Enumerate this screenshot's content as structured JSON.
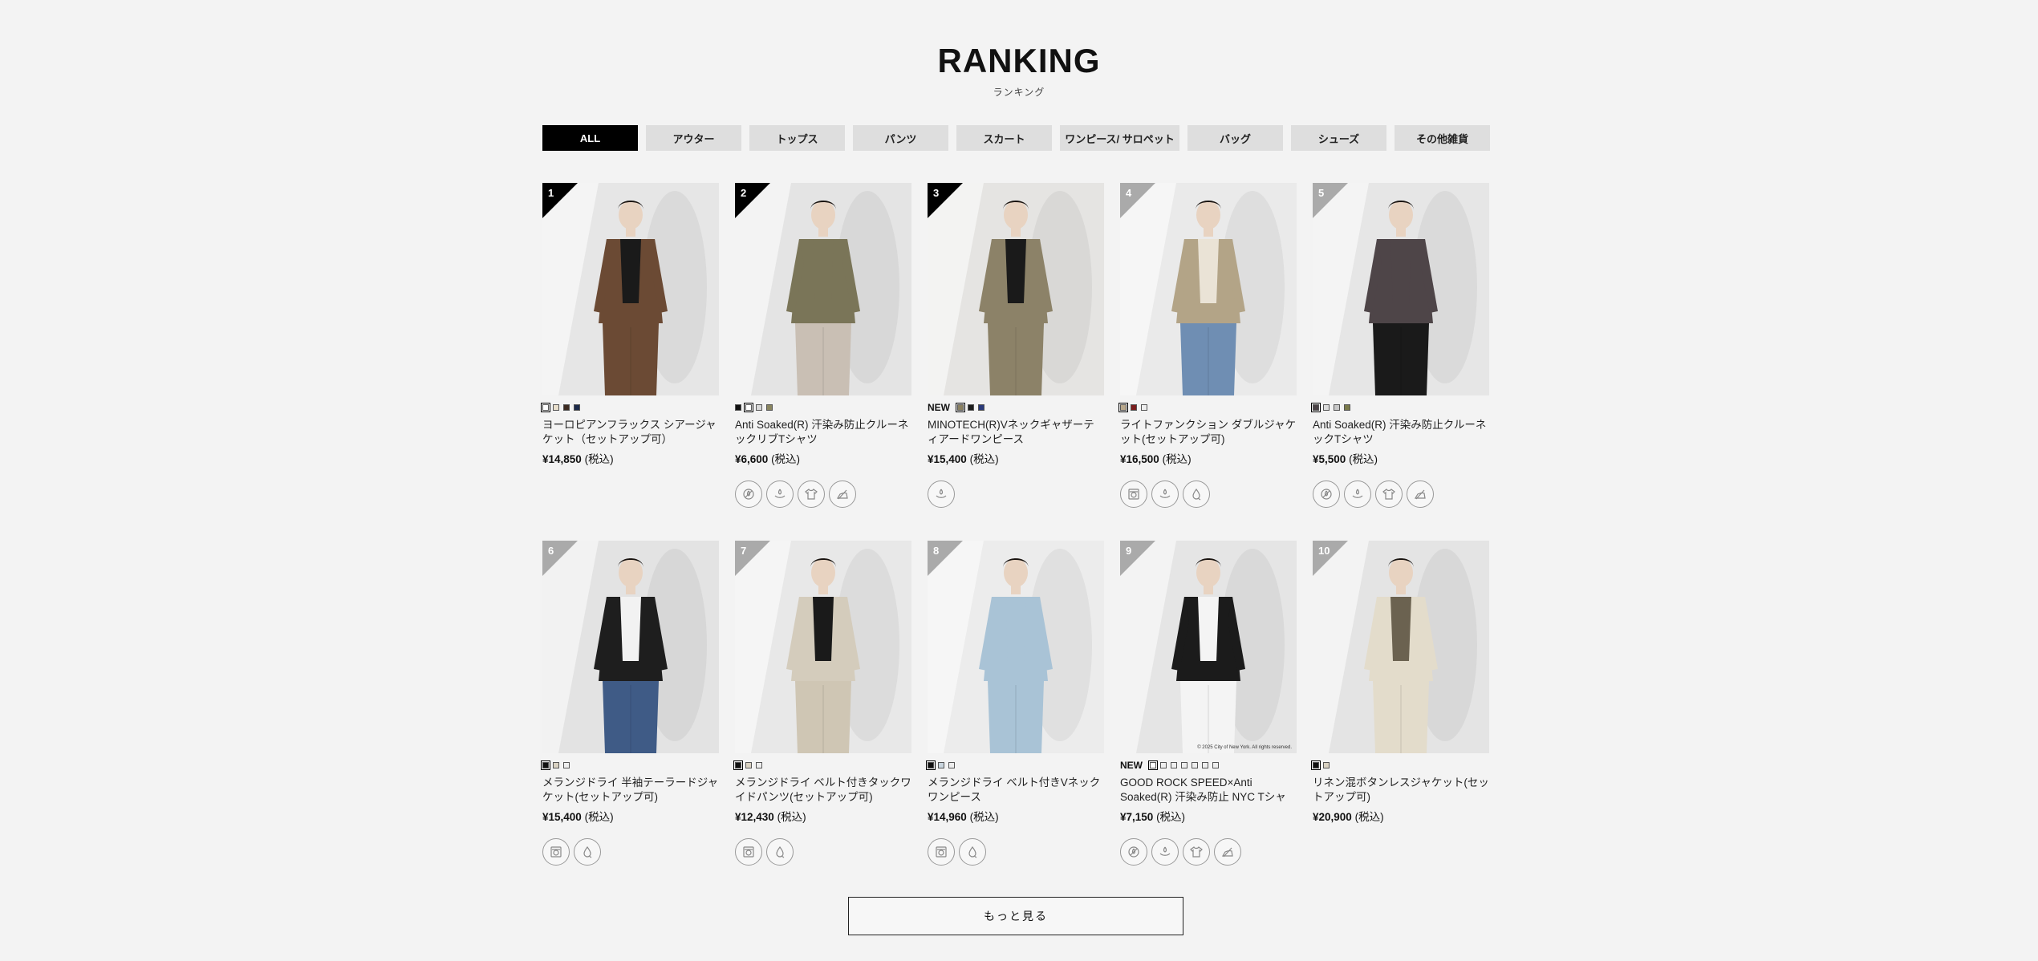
{
  "header": {
    "title": "RANKING",
    "subtitle": "ランキング"
  },
  "tabs": [
    {
      "label": "ALL",
      "active": true
    },
    {
      "label": "アウター"
    },
    {
      "label": "トップス"
    },
    {
      "label": "パンツ"
    },
    {
      "label": "スカート"
    },
    {
      "label": "ワンピース/ サロペット"
    },
    {
      "label": "バッグ"
    },
    {
      "label": "シューズ"
    },
    {
      "label": "その他雑貨"
    }
  ],
  "products": [
    {
      "rank": "1",
      "is_new": false,
      "name": "ヨーロピアンフラックス シアージャケット（セットアップ可）",
      "price": "¥14,850",
      "tax": "(税込)",
      "swatches": [
        "#ffffff",
        "#e9dfcc",
        "#3d2b20",
        "#1c2a4a"
      ],
      "selected_swatch": 0,
      "icons": [],
      "photo": {
        "bg": "#e6e6e6",
        "garment": "#6b4a34",
        "top": "#1a1a1a",
        "legs": "#6b4a34"
      }
    },
    {
      "rank": "2",
      "is_new": false,
      "name": "Anti Soaked(R) 汗染み防止クルーネックリブTシャツ",
      "price": "¥6,600",
      "tax": "(税込)",
      "swatches": [
        "#111111",
        "#ffffff",
        "#d8d8d8",
        "#8a8660"
      ],
      "selected_swatch": 1,
      "icons": [
        "no-sweat-icon",
        "quick-dry-icon",
        "tshirt-icon",
        "no-iron-icon"
      ],
      "photo": {
        "bg": "#e4e4e4",
        "garment": "#7a7558",
        "top": "#7a7558",
        "legs": "#c9bfb4"
      }
    },
    {
      "rank": "3",
      "is_new": true,
      "name": "MINOTECH(R)Vネックギャザーティアードワンピース",
      "price": "¥15,400",
      "tax": "(税込)",
      "swatches": [
        "#8a8060",
        "#1c1c1c",
        "#2a3a7a"
      ],
      "selected_swatch": 0,
      "icons": [
        "quick-dry-icon"
      ],
      "photo": {
        "bg": "#e5e4e2",
        "garment": "#8c8268",
        "top": "#1a1a1a",
        "legs": "#8c8268"
      }
    },
    {
      "rank": "4",
      "is_new": false,
      "name": "ライトファンクション ダブルジャケット(セットアップ可)",
      "price": "¥16,500",
      "tax": "(税込)",
      "swatches": [
        "#b9a88c",
        "#7a1c1c",
        "#eeeeee"
      ],
      "selected_swatch": 0,
      "icons": [
        "wash-icon",
        "quick-dry-icon",
        "water-repellent-icon"
      ],
      "photo": {
        "bg": "#eaeaea",
        "garment": "#b3a487",
        "top": "#eae3d6",
        "legs": "#6f8eb3"
      }
    },
    {
      "rank": "5",
      "is_new": false,
      "name": "Anti Soaked(R) 汗染み防止クルーネックTシャツ",
      "price": "¥5,500",
      "tax": "(税込)",
      "swatches": [
        "#4a4246",
        "#dcdcdc",
        "#c8c8c8",
        "#7a7a4a"
      ],
      "selected_swatch": 0,
      "icons": [
        "no-sweat-icon",
        "quick-dry-icon",
        "tshirt-icon",
        "no-iron-icon"
      ],
      "photo": {
        "bg": "#e6e6e6",
        "garment": "#4e4548",
        "top": "#4e4548",
        "legs": "#1a1a1a"
      }
    },
    {
      "rank": "6",
      "is_new": false,
      "name": "メランジドライ 半袖テーラードジャケット(セットアップ可)",
      "price": "¥15,400",
      "tax": "(税込)",
      "swatches": [
        "#111111",
        "#d9d2c2",
        "#eeeeee"
      ],
      "selected_swatch": 0,
      "icons": [
        "wash-icon",
        "water-repellent-icon"
      ],
      "photo": {
        "bg": "#e3e3e3",
        "garment": "#1e1e1e",
        "top": "#f2f2f2",
        "legs": "#3f5b86"
      }
    },
    {
      "rank": "7",
      "is_new": false,
      "name": "メランジドライ ベルト付きタックワイドパンツ(セットアップ可)",
      "price": "¥12,430",
      "tax": "(税込)",
      "swatches": [
        "#111111",
        "#d9d2c2",
        "#eeeeee"
      ],
      "selected_swatch": 0,
      "icons": [
        "wash-icon",
        "water-repellent-icon"
      ],
      "photo": {
        "bg": "#e8e8e8",
        "garment": "#d4ccbc",
        "top": "#1a1a1a",
        "legs": "#cfc6b4"
      }
    },
    {
      "rank": "8",
      "is_new": false,
      "name": "メランジドライ ベルト付きVネックワンピース",
      "price": "¥14,960",
      "tax": "(税込)",
      "swatches": [
        "#111111",
        "#c9d5de",
        "#eeeeee"
      ],
      "selected_swatch": 0,
      "icons": [
        "wash-icon",
        "water-repellent-icon"
      ],
      "photo": {
        "bg": "#ececec",
        "garment": "#a9c3d6",
        "top": "#a9c3d6",
        "legs": "#a9c3d6"
      }
    },
    {
      "rank": "9",
      "is_new": true,
      "name": "GOOD ROCK SPEED×Anti Soaked(R) 汗染み防止 NYC Tシャツ",
      "price": "¥7,150",
      "tax": "(税込)",
      "swatches": [
        "#ffffff",
        "#eeeeee",
        "#eeeeee",
        "#eeeeee",
        "#eeeeee",
        "#eeeeee",
        "#eeeeee"
      ],
      "selected_swatch": 0,
      "icons": [
        "no-sweat-icon",
        "quick-dry-icon",
        "tshirt-icon",
        "no-iron-icon"
      ],
      "copyright": "© 2025 City of New York. All rights reserved.",
      "photo": {
        "bg": "#e5e5e5",
        "garment": "#1b1b1b",
        "top": "#f4f4f4",
        "legs": "#f4f4f4"
      }
    },
    {
      "rank": "10",
      "is_new": false,
      "name": "リネン混ボタンレスジャケット(セットアップ可)",
      "price": "¥20,900",
      "tax": "(税込)",
      "swatches": [
        "#111111",
        "#d9d2c2"
      ],
      "selected_swatch": 0,
      "icons": [],
      "photo": {
        "bg": "#e4e4e4",
        "garment": "#e3dccb",
        "top": "#6b6250",
        "legs": "#e3dccb"
      }
    }
  ],
  "more_button": "もっと見る"
}
